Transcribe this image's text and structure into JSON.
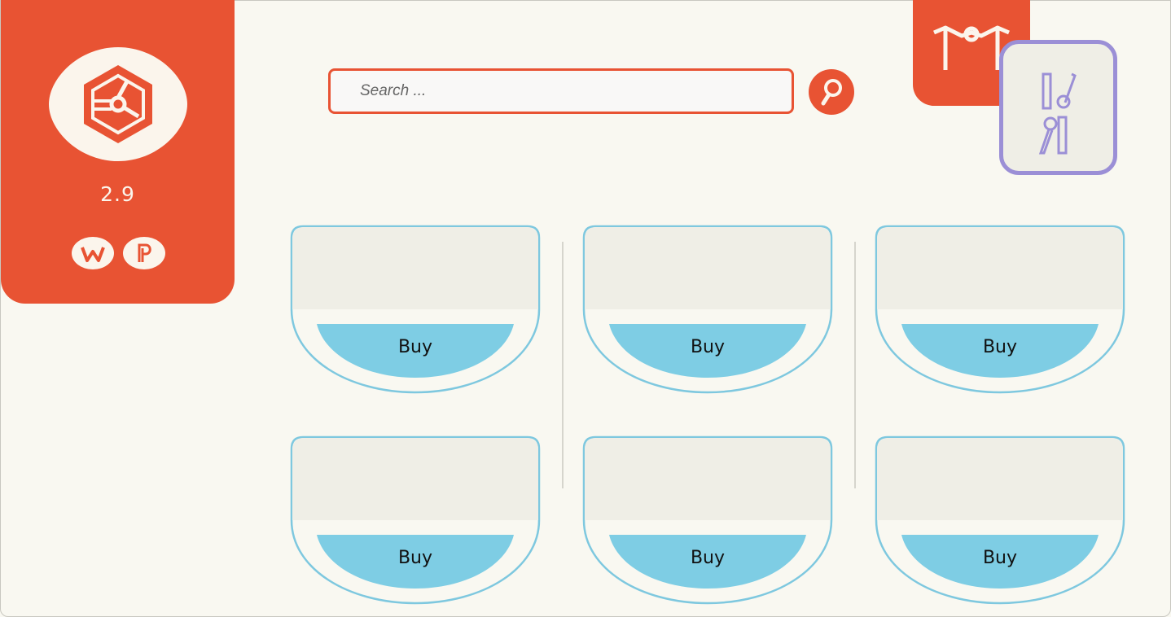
{
  "brand": {
    "version": "2.9",
    "logo_icon": "hexagon-logo-icon",
    "social": [
      {
        "name": "w-social-icon"
      },
      {
        "name": "p-social-icon"
      }
    ]
  },
  "search": {
    "placeholder": "Search ...",
    "value": "",
    "button_icon": "search-icon"
  },
  "header": {
    "profile_icon": "m-profile-icon",
    "tools_icon": "tools-icon"
  },
  "products": [
    {
      "buy_label": "Buy"
    },
    {
      "buy_label": "Buy"
    },
    {
      "buy_label": "Buy"
    },
    {
      "buy_label": "Buy"
    },
    {
      "buy_label": "Buy"
    },
    {
      "buy_label": "Buy"
    }
  ],
  "colors": {
    "accent": "#e85333",
    "card_border": "#7ec8df",
    "buy_fill": "#7ecde4",
    "tools_border": "#9b8fd6",
    "background": "#f9f8f1"
  }
}
